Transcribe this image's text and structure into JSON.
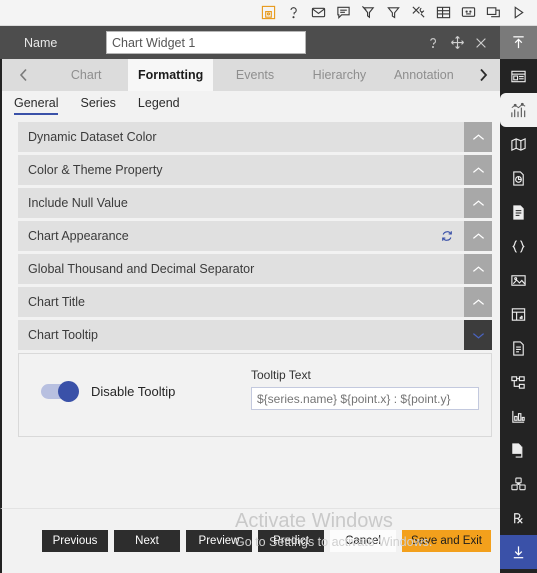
{
  "topbar": {
    "icons": [
      {
        "name": "save-icon",
        "accent": "#e89a1c"
      },
      {
        "name": "help-icon",
        "accent": "#3a3a3a"
      },
      {
        "name": "mail-icon",
        "accent": "#3a3a3a"
      },
      {
        "name": "comment-icon",
        "accent": "#3a3a3a"
      },
      {
        "name": "filter-clear-icon",
        "accent": "#3a3a3a"
      },
      {
        "name": "filter-icon",
        "accent": "#3a3a3a"
      },
      {
        "name": "tools-icon",
        "accent": "#3a3a3a"
      },
      {
        "name": "table-icon",
        "accent": "#3a3a3a"
      },
      {
        "name": "presentation-icon",
        "accent": "#3a3a3a"
      },
      {
        "name": "window-copy-icon",
        "accent": "#3a3a3a"
      },
      {
        "name": "play-icon",
        "accent": "#3a3a3a"
      }
    ]
  },
  "header": {
    "name_label": "Name",
    "name_value": "Chart Widget 1",
    "name_placeholder": "Chart Widget 1",
    "help_icon": "help-icon",
    "move_icon": "move-icon",
    "close_icon": "close-icon",
    "collapse_icon": "collapse-up-icon"
  },
  "tabs": {
    "prev_arrow": "chevron-left-icon",
    "next_arrow": "chevron-right-icon",
    "items": [
      {
        "label": "Chart",
        "active": false
      },
      {
        "label": "Formatting",
        "active": true
      },
      {
        "label": "Events",
        "active": false
      },
      {
        "label": "Hierarchy",
        "active": false
      },
      {
        "label": "Annotation",
        "active": false
      }
    ]
  },
  "subtabs": {
    "items": [
      {
        "label": "General",
        "active": true
      },
      {
        "label": "Series",
        "active": false
      },
      {
        "label": "Legend",
        "active": false
      }
    ],
    "active_color": "#3a51a8"
  },
  "sections": [
    {
      "title": "Dynamic Dataset Color",
      "open": false,
      "refresh": false
    },
    {
      "title": "Color & Theme Property",
      "open": false,
      "refresh": false
    },
    {
      "title": "Include Null Value",
      "open": false,
      "refresh": false
    },
    {
      "title": "Chart Appearance",
      "open": false,
      "refresh": true
    },
    {
      "title": "Global Thousand and Decimal Separator",
      "open": false,
      "refresh": false
    },
    {
      "title": "Chart Title",
      "open": false,
      "refresh": false
    },
    {
      "title": "Chart Tooltip",
      "open": true,
      "refresh": false
    }
  ],
  "tooltip_panel": {
    "toggle_label": "Disable Tooltip",
    "toggle_on": true,
    "toggle_color": "#3a51a8",
    "text_label": "Tooltip Text",
    "text_value": "",
    "text_placeholder": "${series.name} ${point.x} : ${point.y}"
  },
  "footer": {
    "buttons": [
      {
        "label": "Previous",
        "style": "dark"
      },
      {
        "label": "Next",
        "style": "dark"
      },
      {
        "label": "Preview",
        "style": "dark"
      },
      {
        "label": "Predict",
        "style": "dark"
      },
      {
        "label": "Cancel",
        "style": "light"
      },
      {
        "label": "Save and Exit",
        "style": "accent"
      }
    ],
    "accent_color": "#f3a01c"
  },
  "watermark": {
    "line1": "Activate Windows",
    "line2": "Go to Settings to activate Windows."
  },
  "rail": {
    "top_icon": "collapse-up-icon",
    "icons": [
      {
        "name": "widget-icon",
        "state": "normal"
      },
      {
        "name": "chart-icon",
        "state": "selected"
      },
      {
        "name": "map-icon",
        "state": "normal"
      },
      {
        "name": "document-chart-icon",
        "state": "normal"
      },
      {
        "name": "document-icon",
        "state": "normal"
      },
      {
        "name": "code-braces-icon",
        "state": "normal"
      },
      {
        "name": "image-icon",
        "state": "normal"
      },
      {
        "name": "grid-card-icon",
        "state": "normal"
      },
      {
        "name": "report-icon",
        "state": "normal"
      },
      {
        "name": "hierarchy-icon",
        "state": "normal"
      },
      {
        "name": "bar-stats-icon",
        "state": "normal"
      },
      {
        "name": "copy-page-icon",
        "state": "normal"
      },
      {
        "name": "cube-group-icon",
        "state": "normal"
      },
      {
        "name": "rx-icon",
        "state": "normal"
      },
      {
        "name": "download-icon",
        "state": "blue"
      }
    ]
  }
}
